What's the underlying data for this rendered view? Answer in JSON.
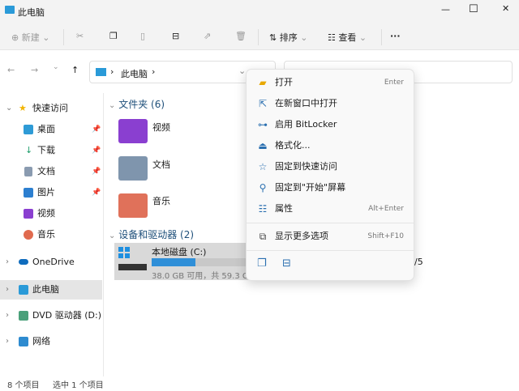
{
  "window": {
    "title": "此电脑",
    "minimize": "—",
    "maximize": "☐",
    "close": "✕"
  },
  "toolbar": {
    "new": "新建",
    "sort": "排序",
    "view": "查看",
    "more": "···"
  },
  "nav": {
    "back": "←",
    "forward": "→",
    "recent": "⌄",
    "up": "↑",
    "breadcrumb": "此电脑",
    "sep": "›",
    "dropdown": "⌄"
  },
  "sidebar": {
    "quick_access": "快速访问",
    "items": [
      {
        "label": "桌面",
        "color": "#2e9bd6"
      },
      {
        "label": "下载",
        "color": "#1f9e6c"
      },
      {
        "label": "文档",
        "color": "#8a9bb0"
      },
      {
        "label": "图片",
        "color": "#2c7fd0"
      },
      {
        "label": "视频",
        "color": "#8a3fd0"
      },
      {
        "label": "音乐",
        "color": "#e06a4e"
      }
    ],
    "onedrive": "OneDrive",
    "this_pc": "此电脑",
    "dvd": "DVD 驱动器 (D:) CI",
    "network": "网络"
  },
  "main": {
    "folders_header": "文件夹 (6)",
    "folders": [
      {
        "label": "视频",
        "color": "#8a3fd0"
      },
      {
        "label": "文档",
        "color": "#7f95ad"
      },
      {
        "label": "音乐",
        "color": "#e0715a"
      }
    ],
    "devices_header": "设备和驱动器 (2)",
    "drive": {
      "name": "本地磁盘 (C:)",
      "space": "38.0 GB 可用，共 59.3 GB",
      "used_fraction": 0.36,
      "bar_color": "#2f8fd8"
    },
    "second_drive_fragment": "/5"
  },
  "menu": {
    "items": [
      {
        "icon": "folder-icon",
        "glyph": "▰",
        "label": "打开",
        "shortcut": "Enter"
      },
      {
        "icon": "open-new-window-icon",
        "glyph": "⇱",
        "label": "在新窗口中打开",
        "shortcut": ""
      },
      {
        "icon": "bitlocker-key-icon",
        "glyph": "⊶",
        "label": "启用 BitLocker",
        "shortcut": ""
      },
      {
        "icon": "format-icon",
        "glyph": "⏏",
        "label": "格式化...",
        "shortcut": ""
      },
      {
        "icon": "star-icon",
        "glyph": "☆",
        "label": "固定到快速访问",
        "shortcut": ""
      },
      {
        "icon": "pin-icon",
        "glyph": "⚲",
        "label": "固定到\"开始\"屏幕",
        "shortcut": ""
      },
      {
        "icon": "properties-icon",
        "glyph": "☷",
        "label": "属性",
        "shortcut": "Alt+Enter"
      }
    ],
    "more": {
      "label": "显示更多选项",
      "shortcut": "Shift+F10"
    }
  },
  "status": {
    "count": "8 个项目",
    "selected": "选中 1 个项目"
  }
}
